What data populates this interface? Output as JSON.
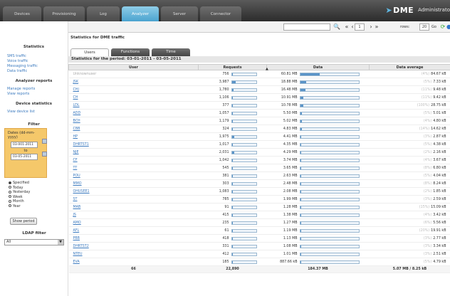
{
  "topbar": {
    "tabs": [
      "Devices",
      "Provisioning",
      "Log",
      "Analyzer",
      "Server",
      "Connector"
    ],
    "active_tab": "Analyzer",
    "brand": "DME",
    "user": "Administrato"
  },
  "toolbar": {
    "page": "1",
    "rows_label": "rows:",
    "rows": "20",
    "go_label": "Go"
  },
  "sidebar": {
    "statistics_heading": "Statistics",
    "statistics_links": [
      "SMS traffic",
      "Voice traffic",
      "Messaging traffic",
      "Data traffic"
    ],
    "analyzer_heading": "Analyzer reports",
    "analyzer_links": [
      "Manage reports",
      "View reports"
    ],
    "device_heading": "Device statistics",
    "device_links": [
      "View device list"
    ],
    "filter_heading": "Filter",
    "filter_date_label": "Dates (dd-mm-yyyy)",
    "date_from": "03-001-2011",
    "date_to_label": "to",
    "date_to": "03-05-2011",
    "periods": [
      "Specified",
      "Today",
      "Yesterday",
      "Week",
      "Month",
      "Year"
    ],
    "selected_period": "Specified",
    "show_button": "Show period",
    "ldap_heading": "LDAP filter",
    "ldap_value": "All"
  },
  "main": {
    "title": "Statistics for DME traffic",
    "tabs": [
      "Users",
      "Functions",
      "Time"
    ],
    "active_tab": "Users",
    "period_text": "Statistics for the period: 03-01-2011 - 03-05-2011",
    "columns": [
      "User",
      "Requests",
      "Data",
      "Data average"
    ],
    "sort_marker": "▲",
    "rows": [
      {
        "user": "Unknownuser",
        "requests": "756",
        "req_frac": 0.03,
        "data": "60.81 MB",
        "data_frac": 0.33,
        "pct": "(4%)",
        "avg": "84.67 kB"
      },
      {
        "user": "JSK",
        "requests": "3,987",
        "req_frac": 0.17,
        "data": "18.88 MB",
        "data_frac": 0.1,
        "pct": "(5%)",
        "avg": "7.33 kB"
      },
      {
        "user": "CHJ",
        "requests": "1,780",
        "req_frac": 0.08,
        "data": "16.48 MB",
        "data_frac": 0.09,
        "pct": "(11%)",
        "avg": "9.48 kB"
      },
      {
        "user": "CH",
        "requests": "1,106",
        "req_frac": 0.05,
        "data": "10.91 MB",
        "data_frac": 0.06,
        "pct": "(11%)",
        "avg": "9.42 kB"
      },
      {
        "user": "LDL",
        "requests": "377",
        "req_frac": 0.02,
        "data": "10.78 MB",
        "data_frac": 0.06,
        "pct": "(100%)",
        "avg": "28.75 kB"
      },
      {
        "user": "ADD",
        "requests": "1,057",
        "req_frac": 0.05,
        "data": "5.50 MB",
        "data_frac": 0.03,
        "pct": "(5%)",
        "avg": "5.01 kB"
      },
      {
        "user": "BCH",
        "requests": "1,179",
        "req_frac": 0.05,
        "data": "5.02 MB",
        "data_frac": 0.03,
        "pct": "(4%)",
        "avg": "4.80 kB"
      },
      {
        "user": "CBB",
        "requests": "324",
        "req_frac": 0.01,
        "data": "4.83 MB",
        "data_frac": 0.03,
        "pct": "(14%)",
        "avg": "14.62 kB"
      },
      {
        "user": "HP",
        "requests": "1,975",
        "req_frac": 0.09,
        "data": "4.41 MB",
        "data_frac": 0.02,
        "pct": "(3%)",
        "avg": "2.87 kB"
      },
      {
        "user": "DHRTST1",
        "requests": "1,017",
        "req_frac": 0.04,
        "data": "4.35 MB",
        "data_frac": 0.02,
        "pct": "(5%)",
        "avg": "4.38 kB"
      },
      {
        "user": "NJE",
        "requests": "2,031",
        "req_frac": 0.09,
        "data": "4.29 MB",
        "data_frac": 0.02,
        "pct": "(2%)",
        "avg": "2.16 kB"
      },
      {
        "user": "CF",
        "requests": "1,042",
        "req_frac": 0.04,
        "data": "3.74 MB",
        "data_frac": 0.02,
        "pct": "(4%)",
        "avg": "3.67 kB"
      },
      {
        "user": "TT",
        "requests": "545",
        "req_frac": 0.02,
        "data": "3.65 MB",
        "data_frac": 0.02,
        "pct": "(8%)",
        "avg": "6.80 kB"
      },
      {
        "user": "POU",
        "requests": "381",
        "req_frac": 0.02,
        "data": "2.63 MB",
        "data_frac": 0.01,
        "pct": "(5%)",
        "avg": "4.04 kB"
      },
      {
        "user": "MMO",
        "requests": "303",
        "req_frac": 0.01,
        "data": "2.48 MB",
        "data_frac": 0.01,
        "pct": "(8%)",
        "avg": "8.24 kB"
      },
      {
        "user": "OHUSEE1",
        "requests": "1,083",
        "req_frac": 0.05,
        "data": "2.08 MB",
        "data_frac": 0.01,
        "pct": "(2%)",
        "avg": "1.85 kB"
      },
      {
        "user": "ST",
        "requests": "785",
        "req_frac": 0.03,
        "data": "1.99 MB",
        "data_frac": 0.01,
        "pct": "(3%)",
        "avg": "2.59 kB"
      },
      {
        "user": "MAB",
        "requests": "91",
        "req_frac": 0.004,
        "data": "1.28 MB",
        "data_frac": 0.007,
        "pct": "(15%)",
        "avg": "15.09 kB"
      },
      {
        "user": "JS",
        "requests": "415",
        "req_frac": 0.02,
        "data": "1.38 MB",
        "data_frac": 0.007,
        "pct": "(4%)",
        "avg": "3.42 kB"
      },
      {
        "user": "AMO",
        "requests": "235",
        "req_frac": 0.01,
        "data": "1.27 MB",
        "data_frac": 0.007,
        "pct": "(6%)",
        "avg": "5.56 kB"
      },
      {
        "user": "AFL",
        "requests": "61",
        "req_frac": 0.003,
        "data": "1.19 MB",
        "data_frac": 0.006,
        "pct": "(20%)",
        "avg": "19.91 kB"
      },
      {
        "user": "PBB",
        "requests": "418",
        "req_frac": 0.02,
        "data": "1.13 MB",
        "data_frac": 0.006,
        "pct": "(3%)",
        "avg": "2.77 kB"
      },
      {
        "user": "DHRTST2",
        "requests": "331",
        "req_frac": 0.01,
        "data": "1.08 MB",
        "data_frac": 0.006,
        "pct": "(3%)",
        "avg": "3.34 kB"
      },
      {
        "user": "NTEU",
        "requests": "412",
        "req_frac": 0.02,
        "data": "1.01 MB",
        "data_frac": 0.005,
        "pct": "(3%)",
        "avg": "2.51 kB"
      },
      {
        "user": "EVA",
        "requests": "185",
        "req_frac": 0.008,
        "data": "887.66 kB",
        "data_frac": 0.005,
        "pct": "(5%)",
        "avg": "4.79 kB"
      }
    ],
    "totals": {
      "user": "66",
      "requests": "22,890",
      "data": "184.37 MB",
      "avg": "5.07 MB / 8.25 kB"
    }
  }
}
